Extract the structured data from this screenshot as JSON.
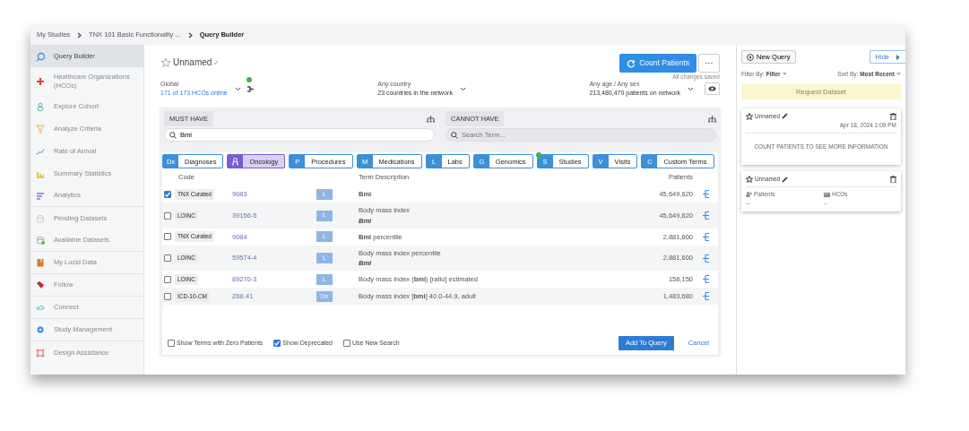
{
  "breadcrumb": [
    {
      "label": "My Studies",
      "current": false
    },
    {
      "label": "TNX 101 Basic Functionality ...",
      "current": false
    },
    {
      "label": "Query Builder",
      "current": true
    }
  ],
  "sidebar": {
    "items": [
      {
        "label": "Query Builder",
        "selected": true,
        "divider": false
      },
      {
        "label": "Healthcare Organizations (HCOs)",
        "selected": false,
        "divider": false
      },
      {
        "label": "Explore Cohort",
        "selected": false,
        "divider": false
      },
      {
        "label": "Analyze Criteria",
        "selected": false,
        "divider": false
      },
      {
        "label": "Rate of Arrival",
        "selected": false,
        "divider": false
      },
      {
        "label": "Summary Statistics",
        "selected": false,
        "divider": false
      },
      {
        "label": "Analytics",
        "selected": false,
        "divider": true
      },
      {
        "label": "Pending Datasets",
        "selected": false,
        "divider": false
      },
      {
        "label": "Available Datasets",
        "selected": false,
        "divider": true
      },
      {
        "label": "My Lucid Data",
        "selected": false,
        "divider": true
      },
      {
        "label": "Follow",
        "selected": false,
        "divider": true
      },
      {
        "label": "Connect",
        "selected": false,
        "divider": true
      },
      {
        "label": "Study Management",
        "selected": false,
        "divider": true
      },
      {
        "label": "Design Assistance",
        "selected": false,
        "divider": false
      }
    ]
  },
  "query": {
    "title": "Unnamed",
    "count_button": "Count Patients",
    "more_button": "···",
    "saved_note": "All changes saved"
  },
  "filters": [
    {
      "label": "Global",
      "detail": "171 of 173 HCOs online",
      "link": true
    },
    {
      "label": "Any country",
      "detail": "23 countries in the network",
      "link": false
    },
    {
      "label": "Any age / Any sex",
      "detail": "213,480,470 patients on network",
      "link": false
    }
  ],
  "must_have": {
    "label": "MUST HAVE",
    "value": "Bmi"
  },
  "cannot_have": {
    "label": "CANNOT HAVE",
    "placeholder": "Search Term..."
  },
  "categories": [
    {
      "code": "Dx",
      "label": "Diagnoses",
      "selected": false,
      "dot": false
    },
    {
      "label": "Oncology",
      "selected": true,
      "dot": false
    },
    {
      "code": "P",
      "label": "Procedures",
      "selected": false,
      "dot": false
    },
    {
      "code": "M",
      "label": "Medications",
      "selected": false,
      "dot": false
    },
    {
      "code": "L",
      "label": "Labs",
      "selected": false,
      "dot": false
    },
    {
      "code": "G",
      "label": "Genomics",
      "selected": false,
      "dot": false
    },
    {
      "code": "S",
      "label": "Studies",
      "selected": false,
      "dot": true
    },
    {
      "code": "V",
      "label": "Visits",
      "selected": false,
      "dot": false
    },
    {
      "code": "C",
      "label": "Custom Terms",
      "selected": false,
      "dot": false
    }
  ],
  "table": {
    "columns": [
      "Code",
      "Term Description",
      "Patients"
    ],
    "rows": [
      {
        "checked": true,
        "system": "TNX Curated",
        "code": "9083",
        "type": "L",
        "description": "**Bmi**",
        "patients": "45,649,620"
      },
      {
        "checked": false,
        "system": "LOINC",
        "code": "39156-5",
        "type": "L",
        "description": "Body mass index",
        "synonym": "Bmi",
        "patients": "45,649,620"
      },
      {
        "checked": false,
        "system": "TNX Curated",
        "code": "9084",
        "type": "L",
        "description": "**Bmi** percentile",
        "patients": "2,881,600"
      },
      {
        "checked": false,
        "system": "LOINC",
        "code": "59574-4",
        "type": "L",
        "description": "Body mass index percentile",
        "synonym": "Bmi",
        "patients": "2,881,600"
      },
      {
        "checked": false,
        "system": "LOINC",
        "code": "89270-3",
        "type": "L",
        "description": "Body mass index (**bmi**) [ratio] estimated",
        "patients": "158,150"
      },
      {
        "checked": false,
        "system": "ICD-10-CM",
        "code": "Z68.41",
        "type": "Dx",
        "description": "Body mass index [**bmi**] 40.0-44.9, adult",
        "patients": "1,483,680"
      }
    ]
  },
  "options": [
    {
      "label": "Show Terms with Zero Patients",
      "checked": false
    },
    {
      "label": "Show Deprecated",
      "checked": true
    },
    {
      "label": "Use New Search",
      "checked": false
    }
  ],
  "add_button": "Add To Query",
  "cancel_button": "Cancel",
  "right_panel": {
    "new_query": "New Query",
    "hide": "Hide",
    "filter_label": "Filter By:",
    "filter_value": "Filter",
    "sort_label": "Sort By:",
    "sort_value": "Most Recent",
    "request": "Request Dataset",
    "cards": [
      {
        "title": "Unnamed",
        "date": "Apr 18, 2024 1:09 PM",
        "message": "COUNT PATIENTS TO SEE MORE INFORMATION"
      },
      {
        "title": "Unnamed",
        "stats": [
          {
            "label": "Patients",
            "value": "--"
          },
          {
            "label": "HCOs",
            "value": "--"
          }
        ]
      }
    ]
  }
}
